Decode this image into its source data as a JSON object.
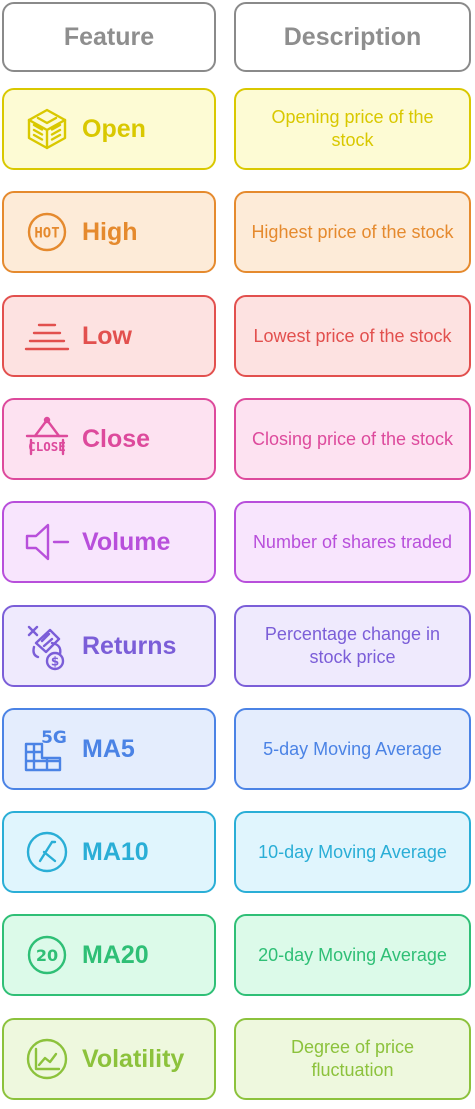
{
  "header": {
    "feature_label": "Feature",
    "description_label": "Description"
  },
  "rows": [
    {
      "feature": "Open",
      "description": "Opening price of the stock",
      "icon": "cube-lines-icon",
      "color": "#d9c800",
      "bg": "#fdfbd4"
    },
    {
      "feature": "High",
      "description": "Highest price of the stock",
      "icon": "hot-badge-icon",
      "color": "#e58a2e",
      "bg": "#fdebd8"
    },
    {
      "feature": "Low",
      "description": "Lowest price of the stock",
      "icon": "low-lines-icon",
      "color": "#e2504e",
      "bg": "#fde2e1"
    },
    {
      "feature": "Close",
      "description": "Closing price of the stock",
      "icon": "close-sign-icon",
      "color": "#dd4a9c",
      "bg": "#fde2f1"
    },
    {
      "feature": "Volume",
      "description": "Number of shares traded",
      "icon": "speaker-icon",
      "color": "#b84fdb",
      "bg": "#f8e5fd"
    },
    {
      "feature": "Returns",
      "description": "Percentage change in stock price",
      "icon": "money-return-icon",
      "color": "#7b5ed8",
      "bg": "#efeafd"
    },
    {
      "feature": "MA5",
      "description": "5-day Moving Average",
      "icon": "5g-grid-icon",
      "color": "#4b83e5",
      "bg": "#e4edfd"
    },
    {
      "feature": "MA10",
      "description": "10-day Moving Average",
      "icon": "circle-x-icon",
      "color": "#2aaed6",
      "bg": "#e0f5fd"
    },
    {
      "feature": "MA20",
      "description": "20-day Moving Average",
      "icon": "circle-20-icon",
      "color": "#2fbf76",
      "bg": "#dcfae9"
    },
    {
      "feature": "Volatility",
      "description": "Degree of price fluctuation",
      "icon": "chart-circle-icon",
      "color": "#8cc23c",
      "bg": "#eef8de"
    }
  ]
}
